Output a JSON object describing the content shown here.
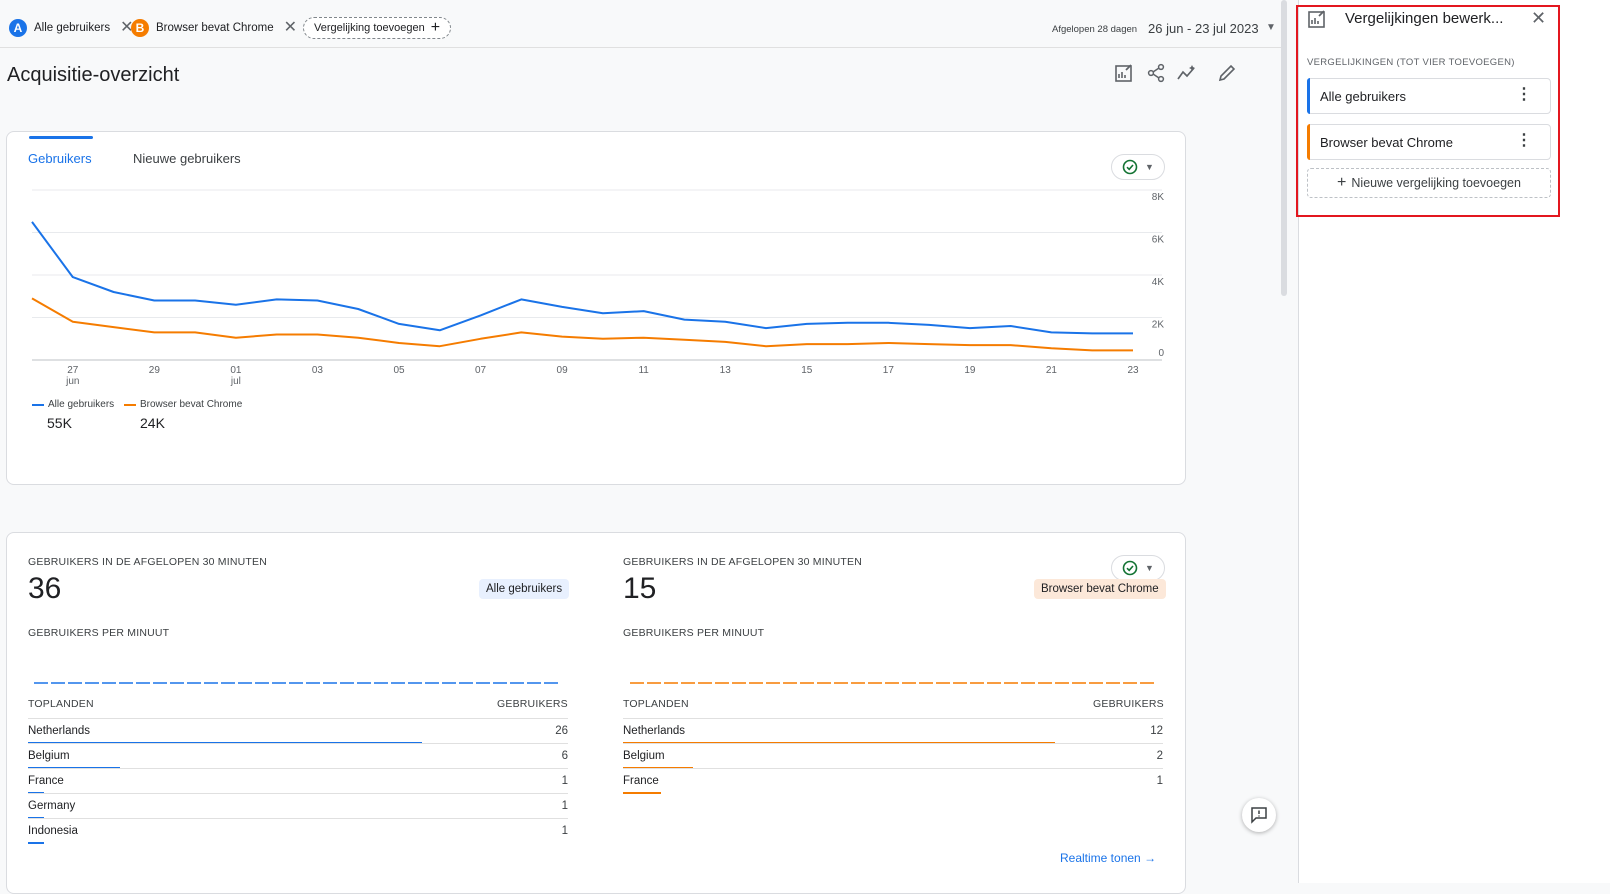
{
  "filters": {
    "chip_a": {
      "letter": "A",
      "label": "Alle gebruikers",
      "color": "#1a73e8"
    },
    "chip_b": {
      "letter": "B",
      "label": "Browser bevat Chrome",
      "color": "#f57c00"
    },
    "add_compare_label": "Vergelijking toevoegen"
  },
  "date": {
    "period_label": "Afgelopen 28 dagen",
    "range": "26 jun - 23 jul 2023"
  },
  "page_title": "Acquisitie-overzicht",
  "toolbar_icons": [
    "customize-report-icon",
    "share-icon",
    "insights-icon",
    "edit-icon"
  ],
  "chart_card": {
    "tabs": [
      "Gebruikers",
      "Nieuwe gebruikers"
    ],
    "active_tab": "Gebruikers"
  },
  "chart_data": {
    "type": "line",
    "x": [
      "26",
      "27",
      "28",
      "29",
      "30",
      "01",
      "02",
      "03",
      "04",
      "05",
      "06",
      "07",
      "08",
      "09",
      "10",
      "11",
      "12",
      "13",
      "14",
      "15",
      "16",
      "17",
      "18",
      "19",
      "20",
      "21",
      "22",
      "23"
    ],
    "x_tick_labels": [
      {
        "day": "27",
        "month": "jun"
      },
      {
        "day": "29",
        "month": ""
      },
      {
        "day": "01",
        "month": "jul"
      },
      {
        "day": "03",
        "month": ""
      },
      {
        "day": "05",
        "month": ""
      },
      {
        "day": "07",
        "month": ""
      },
      {
        "day": "09",
        "month": ""
      },
      {
        "day": "11",
        "month": ""
      },
      {
        "day": "13",
        "month": ""
      },
      {
        "day": "15",
        "month": ""
      },
      {
        "day": "17",
        "month": ""
      },
      {
        "day": "19",
        "month": ""
      },
      {
        "day": "21",
        "month": ""
      },
      {
        "day": "23",
        "month": ""
      }
    ],
    "y_ticks": [
      "8K",
      "6K",
      "4K",
      "2K",
      "0"
    ],
    "ylim": [
      0,
      8000
    ],
    "series": [
      {
        "name": "Alle gebruikers",
        "color": "#1a73e8",
        "total": "55K",
        "values": [
          6500,
          3900,
          3200,
          2800,
          2800,
          2600,
          2850,
          2800,
          2400,
          1700,
          1400,
          2100,
          2850,
          2500,
          2200,
          2300,
          1900,
          1800,
          1500,
          1700,
          1750,
          1750,
          1650,
          1500,
          1600,
          1300,
          1250,
          1250
        ]
      },
      {
        "name": "Browser bevat Chrome",
        "color": "#f57c00",
        "total": "24K",
        "values": [
          2900,
          1800,
          1550,
          1300,
          1300,
          1050,
          1200,
          1200,
          1050,
          800,
          650,
          1000,
          1300,
          1100,
          1000,
          1050,
          950,
          850,
          650,
          750,
          750,
          800,
          750,
          700,
          700,
          550,
          450,
          450
        ]
      }
    ],
    "grid": true
  },
  "realtime": {
    "left": {
      "heading": "GEBRUIKERS IN DE AFGELOPEN 30 MINUTEN",
      "count": "36",
      "badge": "Alle gebruikers",
      "per_minute_heading": "GEBRUIKERS PER MINUUT",
      "table_header_country": "TOPLANDEN",
      "table_header_users": "GEBRUIKERS",
      "rows": [
        {
          "country": "Netherlands",
          "users": "26",
          "share": 0.73
        },
        {
          "country": "Belgium",
          "users": "6",
          "share": 0.17
        },
        {
          "country": "France",
          "users": "1",
          "share": 0.03
        },
        {
          "country": "Germany",
          "users": "1",
          "share": 0.03
        },
        {
          "country": "Indonesia",
          "users": "1",
          "share": 0.03
        }
      ]
    },
    "right": {
      "heading": "GEBRUIKERS IN DE AFGELOPEN 30 MINUTEN",
      "count": "15",
      "badge": "Browser bevat Chrome",
      "per_minute_heading": "GEBRUIKERS PER MINUUT",
      "table_header_country": "TOPLANDEN",
      "table_header_users": "GEBRUIKERS",
      "rows": [
        {
          "country": "Netherlands",
          "users": "12",
          "share": 0.8
        },
        {
          "country": "Belgium",
          "users": "2",
          "share": 0.13
        },
        {
          "country": "France",
          "users": "1",
          "share": 0.07
        }
      ]
    },
    "link_label": "Realtime tonen"
  },
  "side_panel": {
    "title": "Vergelijkingen bewerk...",
    "subtitle": "VERGELIJKINGEN (TOT VIER TOEVOEGEN)",
    "items": [
      {
        "label": "Alle gebruikers",
        "color": "#1a73e8"
      },
      {
        "label": "Browser bevat Chrome",
        "color": "#f57c00"
      }
    ],
    "add_label": "Nieuwe vergelijking toevoegen"
  }
}
